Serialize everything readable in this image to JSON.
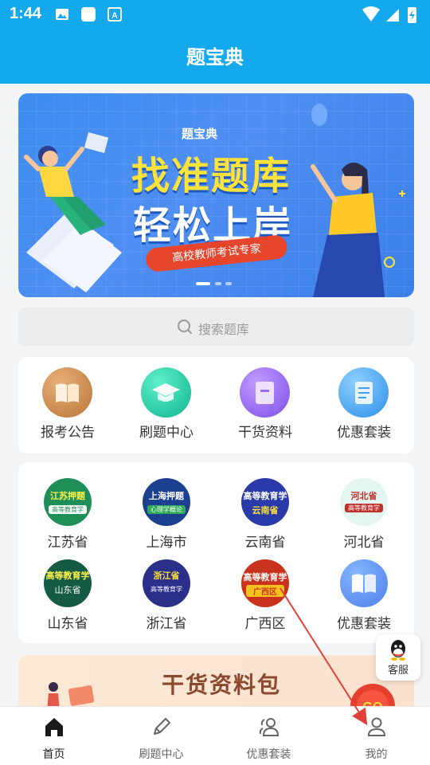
{
  "status": {
    "time": "1:44",
    "icons": [
      "image-icon",
      "app-icon",
      "font-icon",
      "wifi-icon",
      "battery-icon"
    ]
  },
  "header": {
    "title": "题宝典"
  },
  "banner": {
    "brand": "题宝典",
    "line1": "找准题库",
    "line2": "轻松上岸",
    "ribbon": "高校教师考试专家",
    "page_index": 0,
    "page_count": 3
  },
  "search": {
    "placeholder": "搜索题库"
  },
  "features": [
    {
      "label": "报考公告",
      "icon": "book-icon",
      "color": "#c98a4b"
    },
    {
      "label": "刷题中心",
      "icon": "graduation-cap-icon",
      "color": "#1fc9a6"
    },
    {
      "label": "干货资料",
      "icon": "document-icon",
      "color": "#9b6cf0"
    },
    {
      "label": "优惠套装",
      "icon": "scroll-icon",
      "color": "#3fa0ef"
    }
  ],
  "provinces": [
    {
      "label": "江苏省",
      "badge": "江苏押题",
      "sub": "高等教育学"
    },
    {
      "label": "上海市",
      "badge": "上海押题",
      "sub": "心理学概论"
    },
    {
      "label": "云南省",
      "badge": "高等教育学",
      "sub": "云南省"
    },
    {
      "label": "河北省",
      "badge": "河北省",
      "sub": "高等教育学"
    },
    {
      "label": "山东省",
      "badge": "高等教育学",
      "sub": "山东省"
    },
    {
      "label": "浙江省",
      "badge": "浙江省",
      "sub": "高等教育学"
    },
    {
      "label": "广西区",
      "badge": "高等教育学",
      "sub": "广西区"
    },
    {
      "label": "优惠套装",
      "badge": "",
      "sub": ""
    }
  ],
  "promo": {
    "title": "干货资料包"
  },
  "service": {
    "label": "客服"
  },
  "tabs": [
    {
      "label": "首页",
      "icon": "home-icon",
      "active": true
    },
    {
      "label": "刷题中心",
      "icon": "pencil-icon",
      "active": false
    },
    {
      "label": "优惠套装",
      "icon": "users-icon",
      "active": false
    },
    {
      "label": "我的",
      "icon": "user-icon",
      "active": false
    }
  ]
}
